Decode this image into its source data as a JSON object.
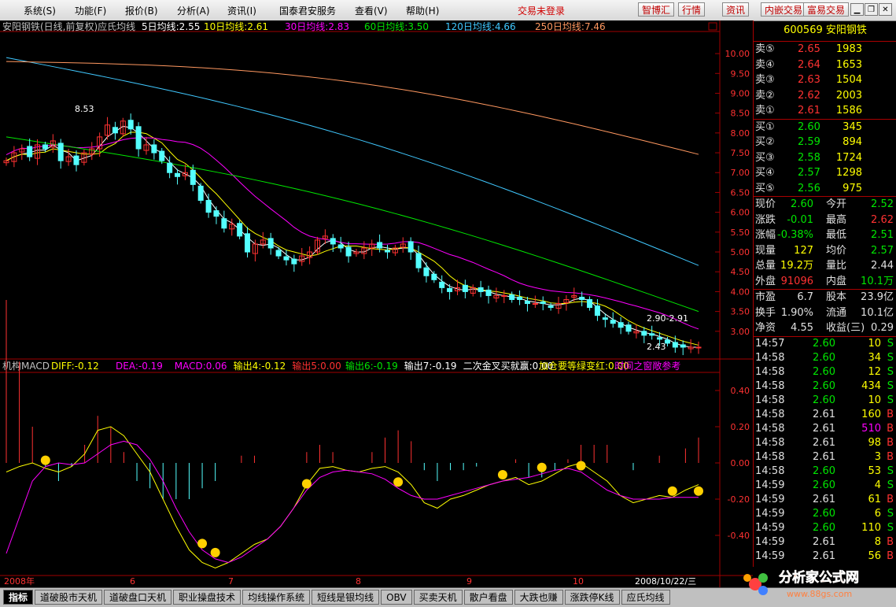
{
  "menu": {
    "items": [
      "系统(S)",
      "功能(F)",
      "报价(B)",
      "分析(A)",
      "资讯(I)",
      "国泰君安服务",
      "查看(V)",
      "帮助(H)"
    ],
    "trade_status": "交易未登录",
    "toolbar": [
      "智博汇",
      "行情",
      "资讯",
      "内嵌交易",
      "富易交易"
    ]
  },
  "colors": {
    "up": "#ff3232",
    "down": "#54ffff",
    "ma5": "#ffffff",
    "ma10": "#ffff00",
    "ma30": "#ff00ff",
    "ma60": "#00e600",
    "ma120": "#40c8ff",
    "ma250": "#ff9860"
  },
  "main_header": {
    "title": "安阳钢铁(日线,前复权)应氏均线",
    "ma": [
      {
        "label": "5日均线:2.55",
        "color": "#ffffff"
      },
      {
        "label": "10日均线:2.61",
        "color": "#ffff00"
      },
      {
        "label": "30日均线:2.83",
        "color": "#ff00ff"
      },
      {
        "label": "60日均线:3.50",
        "color": "#00e600"
      },
      {
        "label": "120日均线:4.66",
        "color": "#40c8ff"
      },
      {
        "label": "250日均线:7.46",
        "color": "#ff9860"
      }
    ]
  },
  "chart_data": [
    {
      "type": "candlestick",
      "title": "安阳钢铁(日线,前复权)应氏均线",
      "ylim": [
        2.5,
        10.2
      ],
      "yticks": [
        "10.00",
        "9.50",
        "9.00",
        "8.50",
        "8.00",
        "7.50",
        "7.00",
        "6.50",
        "6.00",
        "5.50",
        "5.00",
        "4.50",
        "4.00",
        "3.50",
        "3.00"
      ],
      "annotations": [
        "8.53",
        "2.90-2.91",
        "2.43"
      ],
      "x_labels": [
        "2008年",
        "6",
        "7",
        "8",
        "9",
        "10",
        "2008/10/22/三"
      ],
      "series": [
        {
          "name": "5日均线",
          "last": 2.55
        },
        {
          "name": "10日均线",
          "last": 2.61
        },
        {
          "name": "30日均线",
          "last": 2.83
        },
        {
          "name": "60日均线",
          "last": 3.5
        },
        {
          "name": "120日均线",
          "last": 4.66
        },
        {
          "name": "250日均线",
          "last": 7.46
        }
      ],
      "close_path": [
        7.3,
        7.5,
        7.6,
        7.4,
        7.7,
        7.6,
        7.8,
        7.3,
        7.4,
        7.2,
        7.5,
        7.6,
        7.9,
        8.2,
        8.0,
        8.3,
        8.1,
        7.6,
        7.7,
        7.5,
        7.3,
        7.0,
        6.9,
        7.0,
        6.7,
        6.3,
        6.0,
        5.9,
        5.6,
        5.7,
        5.4,
        5.0,
        5.2,
        5.3,
        5.1,
        4.9,
        4.8,
        4.7,
        4.9,
        5.0,
        5.3,
        5.4,
        5.2,
        5.1,
        4.9,
        5.0,
        5.1,
        5.2,
        5.1,
        5.0,
        5.1,
        5.2,
        5.0,
        4.6,
        4.4,
        4.3,
        4.1,
        4.0,
        4.1,
        4.0,
        4.1,
        4.0,
        3.9,
        3.9,
        3.9,
        3.8,
        3.8,
        3.7,
        3.7,
        3.7,
        3.6,
        3.7,
        3.8,
        3.9,
        3.8,
        3.6,
        3.4,
        3.3,
        3.2,
        3.1,
        3.0,
        3.0,
        2.9,
        2.9,
        2.8,
        2.7,
        2.6,
        2.6,
        2.6,
        2.6
      ]
    },
    {
      "type": "bar",
      "title": "机构MACD",
      "ylim": [
        -0.6,
        0.5
      ],
      "yticks": [
        "0.40",
        "0.20",
        "0.00",
        "-0.20",
        "-0.40"
      ],
      "legend": [
        {
          "label": "DIFF:-0.12",
          "color": "#ffff00"
        },
        {
          "label": "DEA:-0.19",
          "color": "#ff00ff"
        },
        {
          "label": "MACD:0.06",
          "color": "#ff00ff"
        },
        {
          "label": "输出4:-0.12",
          "color": "#ffff00"
        },
        {
          "label": "输出5:0.00",
          "color": "#ff3232"
        },
        {
          "label": "输出6:-0.19",
          "color": "#00e600"
        },
        {
          "label": "输出7:-0.19",
          "color": "#ffffff"
        },
        {
          "label": "二次金叉买就赢:0.00",
          "color": "#ffffff"
        },
        {
          "label": "加仓要等绿变红:0.00",
          "color": "#ffff00"
        },
        {
          "label": "时间之窗敞参考",
          "color": "#ff00ff"
        }
      ],
      "diff_path": [
        -0.05,
        -0.02,
        0.0,
        -0.03,
        -0.05,
        -0.02,
        0.05,
        0.18,
        0.2,
        0.15,
        0.05,
        -0.05,
        -0.2,
        -0.35,
        -0.48,
        -0.55,
        -0.58,
        -0.55,
        -0.5,
        -0.45,
        -0.42,
        -0.35,
        -0.25,
        -0.12,
        -0.03,
        -0.02,
        -0.04,
        -0.05,
        -0.03,
        -0.02,
        -0.05,
        -0.12,
        -0.22,
        -0.25,
        -0.2,
        -0.18,
        -0.15,
        -0.12,
        -0.1,
        -0.08,
        -0.12,
        -0.1,
        -0.06,
        -0.02,
        0.0,
        -0.05,
        -0.1,
        -0.18,
        -0.22,
        -0.2,
        -0.18,
        -0.19,
        -0.15,
        -0.12
      ],
      "dea_path": [
        -0.5,
        -0.3,
        -0.1,
        -0.02,
        0.0,
        -0.01,
        0.0,
        0.05,
        0.1,
        0.12,
        0.1,
        0.02,
        -0.1,
        -0.25,
        -0.38,
        -0.48,
        -0.53,
        -0.55,
        -0.52,
        -0.47,
        -0.42,
        -0.35,
        -0.25,
        -0.15,
        -0.08,
        -0.05,
        -0.04,
        -0.05,
        -0.06,
        -0.09,
        -0.14,
        -0.18,
        -0.2,
        -0.2,
        -0.18,
        -0.16,
        -0.14,
        -0.12,
        -0.1,
        -0.09,
        -0.08,
        -0.06,
        -0.04,
        -0.03,
        -0.05,
        -0.1,
        -0.15,
        -0.18,
        -0.2,
        -0.2,
        -0.2,
        -0.19,
        -0.19,
        -0.19
      ]
    }
  ],
  "quote": {
    "title": "600569 安阳钢铁",
    "sell": [
      {
        "label": "卖⑤",
        "price": "2.65",
        "vol": "1983"
      },
      {
        "label": "卖④",
        "price": "2.64",
        "vol": "1653"
      },
      {
        "label": "卖③",
        "price": "2.63",
        "vol": "1504"
      },
      {
        "label": "卖②",
        "price": "2.62",
        "vol": "2003"
      },
      {
        "label": "卖①",
        "price": "2.61",
        "vol": "1586"
      }
    ],
    "buy": [
      {
        "label": "买①",
        "price": "2.60",
        "vol": "345"
      },
      {
        "label": "买②",
        "price": "2.59",
        "vol": "894"
      },
      {
        "label": "买③",
        "price": "2.58",
        "vol": "1724"
      },
      {
        "label": "买④",
        "price": "2.57",
        "vol": "1298"
      },
      {
        "label": "买⑤",
        "price": "2.56",
        "vol": "975"
      }
    ],
    "stats": [
      {
        "l1": "现价",
        "v1": "2.60",
        "c1": "green",
        "l2": "今开",
        "v2": "2.52",
        "c2": "green"
      },
      {
        "l1": "涨跌",
        "v1": "-0.01",
        "c1": "green",
        "l2": "最高",
        "v2": "2.62",
        "c2": "red"
      },
      {
        "l1": "涨幅",
        "v1": "-0.38%",
        "c1": "green",
        "l2": "最低",
        "v2": "2.51",
        "c2": "green"
      },
      {
        "l1": "现量",
        "v1": "127",
        "c1": "yellow",
        "l2": "均价",
        "v2": "2.57",
        "c2": "green"
      },
      {
        "l1": "总量",
        "v1": "19.2万",
        "c1": "yellow",
        "l2": "量比",
        "v2": "2.44",
        "c2": "white"
      },
      {
        "l1": "外盘",
        "v1": "91096",
        "c1": "red",
        "l2": "内盘",
        "v2": "10.1万",
        "c2": "green"
      }
    ],
    "fund": [
      {
        "l1": "市盈",
        "v1": "6.7",
        "l2": "股本",
        "v2": "23.9亿"
      },
      {
        "l1": "换手",
        "v1": "1.90%",
        "l2": "流通",
        "v2": "10.1亿"
      },
      {
        "l1": "净资",
        "v1": "4.55",
        "l2": "收益(三)",
        "v2": "0.29"
      }
    ],
    "ticks": [
      {
        "time": "14:57",
        "price": "2.60",
        "pc": "green",
        "vol": "10",
        "side": "S"
      },
      {
        "time": "14:58",
        "price": "2.60",
        "pc": "green",
        "vol": "34",
        "side": "S"
      },
      {
        "time": "14:58",
        "price": "2.60",
        "pc": "green",
        "vol": "12",
        "side": "S"
      },
      {
        "time": "14:58",
        "price": "2.60",
        "pc": "green",
        "vol": "434",
        "side": "S"
      },
      {
        "time": "14:58",
        "price": "2.60",
        "pc": "green",
        "vol": "10",
        "side": "S"
      },
      {
        "time": "14:58",
        "price": "2.61",
        "pc": "white",
        "vol": "160",
        "side": "B"
      },
      {
        "time": "14:58",
        "price": "2.61",
        "pc": "white",
        "vol": "510",
        "side": "B"
      },
      {
        "time": "14:58",
        "price": "2.61",
        "pc": "white",
        "vol": "98",
        "side": "B"
      },
      {
        "time": "14:58",
        "price": "2.61",
        "pc": "white",
        "vol": "3",
        "side": "B"
      },
      {
        "time": "14:58",
        "price": "2.60",
        "pc": "green",
        "vol": "53",
        "side": "S"
      },
      {
        "time": "14:59",
        "price": "2.60",
        "pc": "green",
        "vol": "4",
        "side": "S"
      },
      {
        "time": "14:59",
        "price": "2.61",
        "pc": "white",
        "vol": "61",
        "side": "B"
      },
      {
        "time": "14:59",
        "price": "2.60",
        "pc": "green",
        "vol": "6",
        "side": "S"
      },
      {
        "time": "14:59",
        "price": "2.60",
        "pc": "green",
        "vol": "110",
        "side": "S"
      },
      {
        "time": "14:59",
        "price": "2.61",
        "pc": "white",
        "vol": "8",
        "side": "B"
      },
      {
        "time": "14:59",
        "price": "2.61",
        "pc": "white",
        "vol": "56",
        "side": "B"
      }
    ]
  },
  "tabs": [
    "指标",
    "道破股市天机",
    "道破盘口天机",
    "职业操盘技术",
    "均线操作系统",
    "短线是银均线",
    "OBV",
    "买卖天机",
    "散户看盘",
    "大跌也赚",
    "涨跌停K线",
    "应氏均线"
  ],
  "side_label": "日线",
  "logo": {
    "text": "分析家公式网",
    "url": "www.88gs.com"
  }
}
